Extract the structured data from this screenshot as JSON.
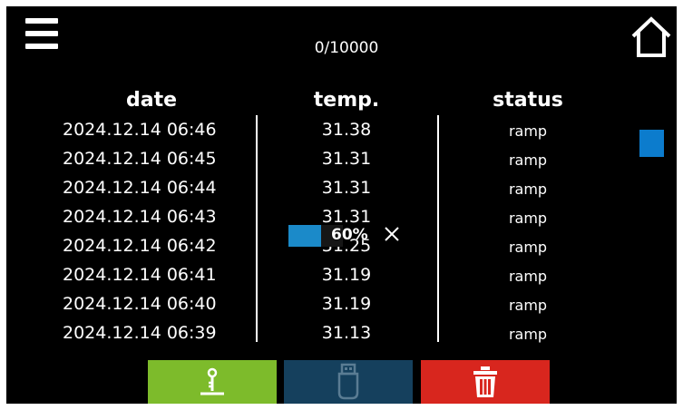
{
  "counter": "0/10000",
  "table": {
    "headers": {
      "date": "date",
      "temp": "temp.",
      "status": "status"
    },
    "rows": [
      {
        "date": "2024.12.14 06:46",
        "temp": "31.38",
        "status": "ramp"
      },
      {
        "date": "2024.12.14 06:45",
        "temp": "31.31",
        "status": "ramp"
      },
      {
        "date": "2024.12.14 06:44",
        "temp": "31.31",
        "status": "ramp"
      },
      {
        "date": "2024.12.14 06:43",
        "temp": "31.31",
        "status": "ramp"
      },
      {
        "date": "2024.12.14 06:42",
        "temp": "31.25",
        "status": "ramp"
      },
      {
        "date": "2024.12.14 06:41",
        "temp": "31.19",
        "status": "ramp"
      },
      {
        "date": "2024.12.14 06:40",
        "temp": "31.19",
        "status": "ramp"
      },
      {
        "date": "2024.12.14 06:39",
        "temp": "31.13",
        "status": "ramp"
      }
    ]
  },
  "progress": {
    "value_percent": 60,
    "label": "60%"
  },
  "toolbar": {
    "download": {
      "icon": "download-icon",
      "color": "#7dbb2b",
      "enabled": true
    },
    "usb": {
      "icon": "usb-icon",
      "color": "#15405d",
      "enabled": false
    },
    "delete": {
      "icon": "trash-icon",
      "color": "#d8261e",
      "enabled": true
    }
  },
  "colors": {
    "background": "#000000",
    "accent": "#0c7ccd"
  }
}
